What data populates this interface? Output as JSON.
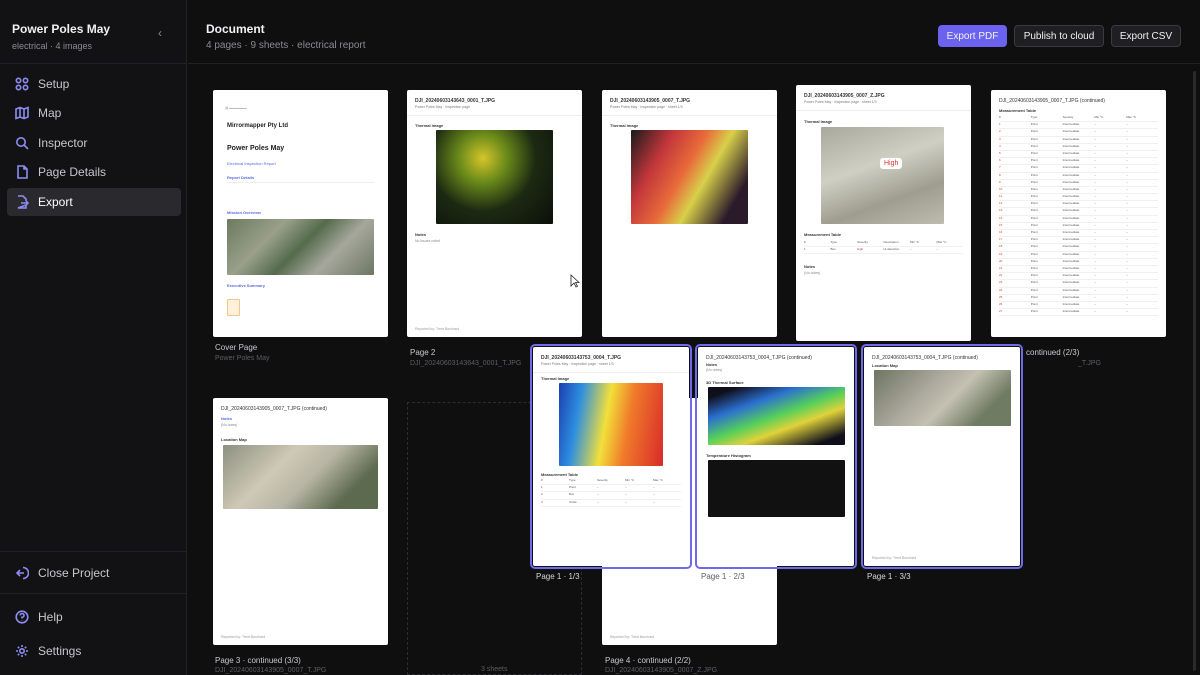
{
  "project": {
    "name": "Power Poles May",
    "subtitle": "electrical · 4 images"
  },
  "sidebar": {
    "items": [
      {
        "label": "Setup",
        "icon": "grid-icon"
      },
      {
        "label": "Map",
        "icon": "map-icon"
      },
      {
        "label": "Inspector",
        "icon": "search-icon"
      },
      {
        "label": "Page Details",
        "icon": "document-icon"
      },
      {
        "label": "Export",
        "icon": "export-icon",
        "active": true
      }
    ],
    "close_project": "Close Project",
    "help": "Help",
    "settings": "Settings"
  },
  "header": {
    "title": "Document",
    "subtitle": "4 pages · 9 sheets · electrical report",
    "export_pdf": "Export PDF",
    "publish": "Publish to cloud",
    "export_csv": "Export CSV"
  },
  "pages": {
    "cover": {
      "company": "Mirrormapper Pty Ltd",
      "title": "Power Poles May",
      "subtitle": "Electrical Inspection Report",
      "report_details": "Report Details",
      "mission_overview": "Mission Overview",
      "executive_summary": "Executive Summary",
      "caption": "Cover Page",
      "caption_sub": "Power Poles May"
    },
    "p2": {
      "file": "DJI_20240603143643_0001_T.JPG",
      "sub": "Power Poles May · Inspection page",
      "thermal": "Thermal Image",
      "notes": "Notes",
      "notes_text": "No issues noted",
      "footer": "Reported by: Trent Borchard",
      "caption": "Page 2",
      "caption_sub": "DJI_20240603143643_0001_T.JPG"
    },
    "p3": {
      "file": "DJI_20240603143905_0007_T.JPG",
      "sub": "Power Poles May · Inspection page · sheet 1/3",
      "thermal": "Thermal Image"
    },
    "p4": {
      "file": "DJI_20240603143905_0007_Z.JPG",
      "sub": "Power Poles May · Inspection page · sheet 1/3",
      "thermal": "Thermal Image",
      "badge": "High",
      "table": "Measurement Table",
      "notes": "Notes",
      "notes_text": "(No notes)"
    },
    "p5": {
      "file": "DJI_20240603143905_0007_T.JPG (continued)",
      "table": "Measurement Table",
      "caption": "continued (2/3)",
      "caption_sub": "_T.JPG"
    },
    "p6": {
      "file": "DJI_20240603143905_0007_T.JPG (continued)",
      "notes": "Notes",
      "notes_text": "(No notes)",
      "map": "Location Map",
      "footer": "Reported by: Trent Borchard",
      "caption": "Page 3 · continued (3/3)",
      "caption_sub": "DJI_20240603143905_0007_T.JPG"
    },
    "drop": {
      "label": "3 sheets"
    },
    "p8": {
      "footer": "Reported by: Trent Borchard",
      "caption": "Page 4 · continued (2/2)",
      "caption_sub": "DJI_20240603143905_0007_Z.JPG"
    },
    "sel1": {
      "file": "DJI_20240603143753_0004_T.JPG",
      "sub": "Power Poles May · Inspection page · sheet 1/3",
      "thermal": "Thermal Image",
      "table": "Measurement Table",
      "caption": "Page 1 · 1/3"
    },
    "sel2": {
      "file": "DJI_20240603143753_0004_T.JPG (continued)",
      "notes": "Notes",
      "notes_text": "(No notes)",
      "surface": "3D Thermal Surface",
      "histogram": "Temperature Histogram",
      "caption": "Page 1 · 2/3"
    },
    "sel3": {
      "file": "DJI_20240603143753_0004_T.JPG (continued)",
      "map": "Location Map",
      "footer": "Reported by: Trent Borchard",
      "caption": "Page 1 · 3/3"
    }
  },
  "colors": {
    "accent": "#6b63f0",
    "selection": "#6f6ae8",
    "severity_high": "#d33333"
  }
}
